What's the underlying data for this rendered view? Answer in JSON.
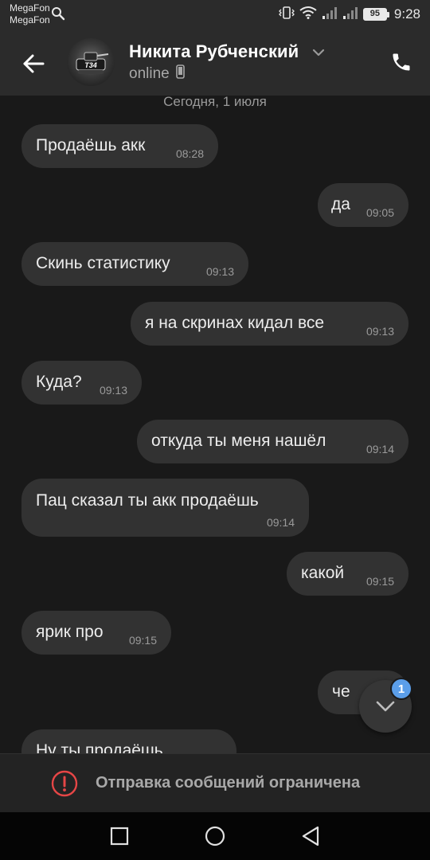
{
  "status_bar": {
    "carrier_1": "MegaFon",
    "carrier_2": "MegaFon",
    "battery": "95",
    "time": "9:28"
  },
  "header": {
    "contact_name": "Никита Рубченский",
    "status": "online",
    "avatar_text": "T34",
    "icons": [
      "back-arrow-icon",
      "chevron-down-icon",
      "mobile-phone-icon",
      "phone-call-icon"
    ]
  },
  "chat": {
    "date_separator": "Сегодня, 1 июля",
    "messages": [
      {
        "side": "in",
        "text": "Продаёшь акк",
        "time": "08:28"
      },
      {
        "side": "out",
        "text": "да",
        "time": "09:05"
      },
      {
        "side": "in",
        "text": "Скинь статистику",
        "time": "09:13"
      },
      {
        "side": "out",
        "text": "я на скринах кидал все",
        "time": "09:13"
      },
      {
        "side": "in",
        "text": "Куда?",
        "time": "09:13"
      },
      {
        "side": "out",
        "text": "откуда ты меня нашёл",
        "time": "09:14"
      },
      {
        "side": "in",
        "text": "Пац сказал ты акк продаёшь",
        "time": "09:14"
      },
      {
        "side": "out",
        "text": "какой",
        "time": "09:15"
      },
      {
        "side": "in",
        "text": "ярик про",
        "time": "09:15"
      },
      {
        "side": "out",
        "text": "че",
        "time": ""
      },
      {
        "side": "in",
        "text": "Ну ты продаёшь",
        "time": ""
      }
    ],
    "unread_count": "1"
  },
  "restriction": {
    "text": "Отправка сообщений ограничена",
    "accent_color": "#e64646"
  },
  "colors": {
    "background": "#191919",
    "bubble": "#323232",
    "header": "#2b2b2b",
    "badge": "#5b9ee9"
  }
}
